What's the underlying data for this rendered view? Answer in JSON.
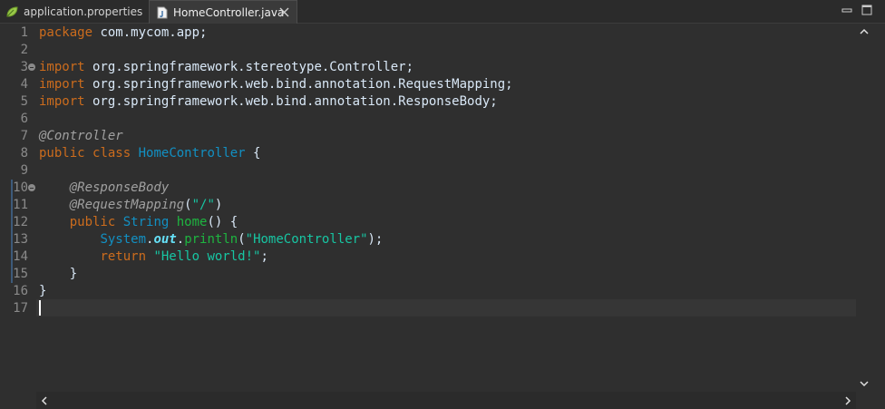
{
  "tabs": [
    {
      "label": "application.properties",
      "active": false,
      "icon": "leaf-icon"
    },
    {
      "label": "HomeController.java",
      "active": true,
      "icon": "java-file-icon"
    }
  ],
  "colors": {
    "keyword": "#cc6c1d",
    "annotation": "#a0a0a0",
    "class": "#1290c3",
    "method": "#1eb540",
    "string": "#17c6a3",
    "field": "#66e1f8",
    "text": "#d9e8f7",
    "background": "#2f2f2f"
  },
  "editor": {
    "line_numbers": [
      "1",
      "2",
      "3",
      "4",
      "5",
      "6",
      "7",
      "8",
      "9",
      "10",
      "11",
      "12",
      "13",
      "14",
      "15",
      "16",
      "17"
    ],
    "current_line": 17,
    "lines": [
      [
        {
          "t": "kw",
          "v": "package"
        },
        {
          "t": "plain",
          "v": " com.mycom.app;"
        }
      ],
      [],
      [
        {
          "t": "kw",
          "v": "import"
        },
        {
          "t": "plain",
          "v": " org.springframework.stereotype.Controller;"
        }
      ],
      [
        {
          "t": "kw",
          "v": "import"
        },
        {
          "t": "plain",
          "v": " org.springframework.web.bind.annotation.RequestMapping;"
        }
      ],
      [
        {
          "t": "kw",
          "v": "import"
        },
        {
          "t": "plain",
          "v": " org.springframework.web.bind.annotation.ResponseBody;"
        }
      ],
      [],
      [
        {
          "t": "ann",
          "v": "@Controller"
        }
      ],
      [
        {
          "t": "kw",
          "v": "public"
        },
        {
          "t": "plain",
          "v": " "
        },
        {
          "t": "kw",
          "v": "class"
        },
        {
          "t": "plain",
          "v": " "
        },
        {
          "t": "cls",
          "v": "HomeController"
        },
        {
          "t": "plain",
          "v": " {"
        }
      ],
      [],
      [
        {
          "t": "plain",
          "v": "    "
        },
        {
          "t": "ann",
          "v": "@ResponseBody"
        }
      ],
      [
        {
          "t": "plain",
          "v": "    "
        },
        {
          "t": "ann",
          "v": "@RequestMapping"
        },
        {
          "t": "plain",
          "v": "("
        },
        {
          "t": "str",
          "v": "\"/\""
        },
        {
          "t": "plain",
          "v": ")"
        }
      ],
      [
        {
          "t": "plain",
          "v": "    "
        },
        {
          "t": "kw",
          "v": "public"
        },
        {
          "t": "plain",
          "v": " "
        },
        {
          "t": "cls",
          "v": "String"
        },
        {
          "t": "plain",
          "v": " "
        },
        {
          "t": "meth",
          "v": "home"
        },
        {
          "t": "plain",
          "v": "() {"
        }
      ],
      [
        {
          "t": "plain",
          "v": "        "
        },
        {
          "t": "cls",
          "v": "System"
        },
        {
          "t": "plain",
          "v": "."
        },
        {
          "t": "fld",
          "v": "out"
        },
        {
          "t": "plain",
          "v": "."
        },
        {
          "t": "meth",
          "v": "println"
        },
        {
          "t": "plain",
          "v": "("
        },
        {
          "t": "str",
          "v": "\"HomeController\""
        },
        {
          "t": "plain",
          "v": ");"
        }
      ],
      [
        {
          "t": "plain",
          "v": "        "
        },
        {
          "t": "kw",
          "v": "return"
        },
        {
          "t": "plain",
          "v": " "
        },
        {
          "t": "str",
          "v": "\"Hello world!\""
        },
        {
          "t": "plain",
          "v": ";"
        }
      ],
      [
        {
          "t": "plain",
          "v": "    }"
        }
      ],
      [
        {
          "t": "plain",
          "v": "}"
        }
      ],
      []
    ]
  }
}
